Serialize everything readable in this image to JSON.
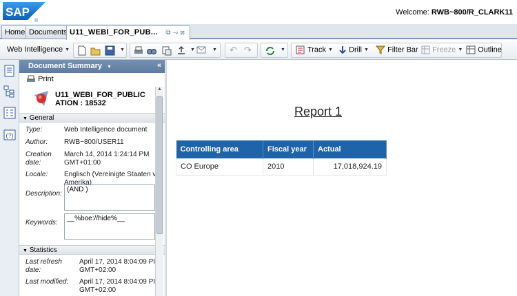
{
  "banner": {
    "logo_text": "SAP",
    "welcome_prefix": "Welcome: ",
    "welcome_user": "RWB~800/R_CLARK11"
  },
  "tabs": [
    {
      "label": "Home"
    },
    {
      "label": "Documents"
    },
    {
      "label": "U11_WEBI_FOR_PUB..."
    }
  ],
  "toolbar": {
    "app_label": "Web Intelligence",
    "track_label": "Track",
    "drill_label": "Drill",
    "filterbar_label": "Filter Bar",
    "freeze_label": "Freeze",
    "outline_label": "Outline"
  },
  "panel": {
    "title": "Document Summary",
    "print_label": "Print",
    "doc_name_line1": "U11_WEBI_FOR_PUBLIC",
    "doc_name_line2": "ATION : 18532",
    "general_label": "General",
    "type_label": "Type:",
    "type_value": "Web Intelligence document",
    "author_label": "Author:",
    "author_value": "RWB~800/USER11",
    "creation_label_1": "Creation",
    "creation_label_2": "date:",
    "creation_value_1": "March 14, 2014 1:24:14 PM",
    "creation_value_2": "GMT+01:00",
    "locale_label": "Locale:",
    "locale_value_1": "Englisch (Vereinigte Staaten v",
    "locale_value_2": "Amerika)",
    "description_label": "Description:",
    "description_value": "(AND )",
    "keywords_label": "Keywords:",
    "keywords_value": "__%boe://hide%__",
    "statistics_label": "Statistics",
    "last_refresh_label_1": "Last refresh",
    "last_refresh_label_2": "date:",
    "last_refresh_value_1": "April 17, 2014 8:04:09 PI",
    "last_refresh_value_2": "GMT+02:00",
    "last_modified_label": "Last modified:",
    "last_modified_value_1": "April 17, 2014 8:04:09 PI",
    "last_modified_value_2": "GMT+02:00"
  },
  "report": {
    "title": "Report 1",
    "columns": [
      "Controlling area",
      "Fiscal year",
      "Actual"
    ],
    "rows": [
      [
        "CO Europe",
        "2010",
        "17,018,924.19"
      ]
    ]
  },
  "colors": {
    "sap_blue": "#1a74c9",
    "header_blue": "#1f63a9",
    "panel_head": "#6886aa"
  }
}
